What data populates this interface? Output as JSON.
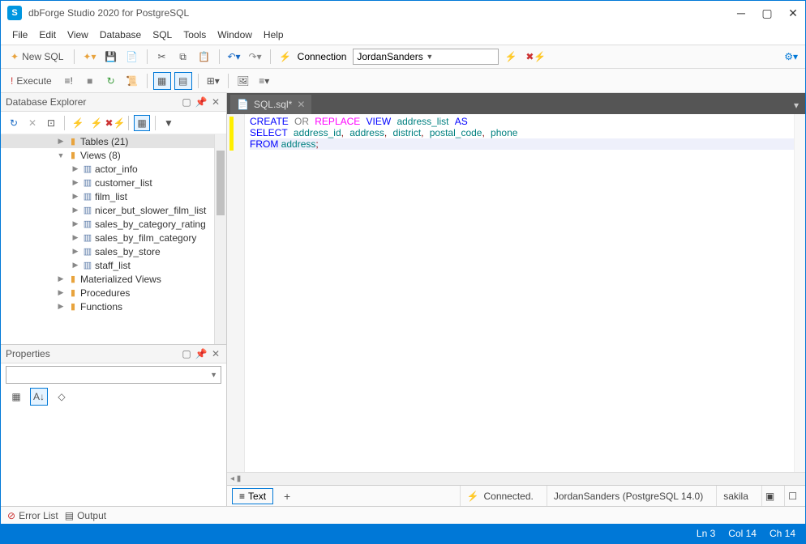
{
  "title": "dbForge Studio 2020 for PostgreSQL",
  "logo_letter": "S",
  "menu": [
    "File",
    "Edit",
    "View",
    "Database",
    "SQL",
    "Tools",
    "Window",
    "Help"
  ],
  "toolbar": {
    "newsql": "New SQL",
    "connection_label": "Connection",
    "connection_value": "JordanSanders",
    "execute": "Execute"
  },
  "db_explorer": {
    "title": "Database Explorer",
    "items": [
      {
        "indent": 68,
        "exp": "▶",
        "icon": "folder",
        "label": "Tables (21)",
        "sel": true
      },
      {
        "indent": 68,
        "exp": "▼",
        "icon": "folder",
        "label": "Views (8)"
      },
      {
        "indent": 86,
        "exp": "▶",
        "icon": "view",
        "label": "actor_info"
      },
      {
        "indent": 86,
        "exp": "▶",
        "icon": "view",
        "label": "customer_list"
      },
      {
        "indent": 86,
        "exp": "▶",
        "icon": "view",
        "label": "film_list"
      },
      {
        "indent": 86,
        "exp": "▶",
        "icon": "view",
        "label": "nicer_but_slower_film_list"
      },
      {
        "indent": 86,
        "exp": "▶",
        "icon": "view",
        "label": "sales_by_category_rating"
      },
      {
        "indent": 86,
        "exp": "▶",
        "icon": "view",
        "label": "sales_by_film_category"
      },
      {
        "indent": 86,
        "exp": "▶",
        "icon": "view",
        "label": "sales_by_store"
      },
      {
        "indent": 86,
        "exp": "▶",
        "icon": "view",
        "label": "staff_list"
      },
      {
        "indent": 68,
        "exp": "▶",
        "icon": "folder",
        "label": "Materialized Views"
      },
      {
        "indent": 68,
        "exp": "▶",
        "icon": "folder",
        "label": "Procedures"
      },
      {
        "indent": 68,
        "exp": "▶",
        "icon": "folder",
        "label": "Functions"
      }
    ]
  },
  "properties": {
    "title": "Properties"
  },
  "tab": {
    "name": "SQL.sql*"
  },
  "sql": {
    "l1": {
      "a": "CREATE",
      "b": "OR",
      "c": "REPLACE",
      "d": "VIEW",
      "e": "address_list",
      "f": "AS"
    },
    "l2": {
      "a": "SELECT",
      "b": "address_id",
      "c": ",",
      "d": "address",
      "e": ",",
      "f": "district",
      "g": ",",
      "h": "postal_code",
      "i": ",",
      "j": "phone"
    },
    "l3": {
      "a": "FROM",
      "b": "address",
      "c": ";"
    }
  },
  "editor_status": {
    "text_btn": "Text",
    "connected": "Connected.",
    "server": "JordanSanders (PostgreSQL 14.0)",
    "db": "sakila"
  },
  "bottom": {
    "errorlist": "Error List",
    "output": "Output"
  },
  "status": {
    "line": "Ln 3",
    "col": "Col 14",
    "ch": "Ch 14"
  }
}
